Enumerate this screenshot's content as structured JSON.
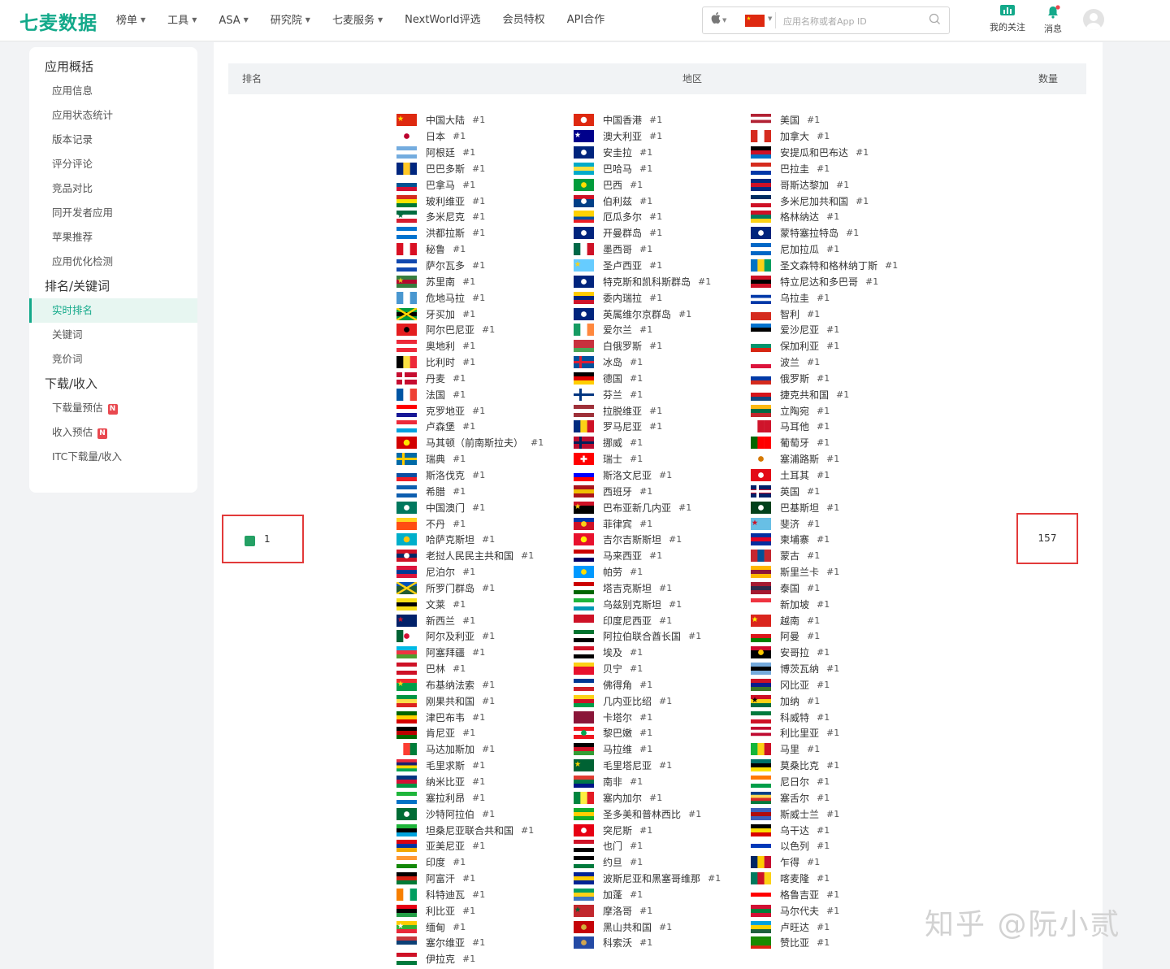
{
  "header": {
    "logo": "七麦数据",
    "nav": [
      {
        "label": "榜单",
        "dropdown": true
      },
      {
        "label": "工具",
        "dropdown": true
      },
      {
        "label": "ASA",
        "dropdown": true
      },
      {
        "label": "研究院",
        "dropdown": true
      },
      {
        "label": "七麦服务",
        "dropdown": true
      },
      {
        "label": "NextWorld评选",
        "dropdown": false
      },
      {
        "label": "会员特权",
        "dropdown": false
      },
      {
        "label": "API合作",
        "dropdown": false
      }
    ],
    "search_placeholder": "应用名称或者App ID",
    "follow_label": "我的关注",
    "message_label": "消息",
    "accent_color": "#13a98a"
  },
  "sidebar": {
    "sections": [
      {
        "title": "应用概括",
        "items": [
          {
            "label": "应用信息"
          },
          {
            "label": "应用状态统计"
          },
          {
            "label": "版本记录"
          },
          {
            "label": "评分评论"
          },
          {
            "label": "竞品对比"
          },
          {
            "label": "同开发者应用"
          },
          {
            "label": "苹果推荐"
          },
          {
            "label": "应用优化检测"
          }
        ]
      },
      {
        "title": "排名/关键词",
        "items": [
          {
            "label": "实时排名",
            "active": true
          },
          {
            "label": "关键词"
          },
          {
            "label": "竞价词"
          }
        ]
      },
      {
        "title": "下载/收入",
        "items": [
          {
            "label": "下载量预估",
            "badge": "N"
          },
          {
            "label": "收入预估",
            "badge": "N"
          },
          {
            "label": "ITC下载量/收入"
          }
        ]
      }
    ]
  },
  "table": {
    "headers": {
      "rank": "排名",
      "region": "地区",
      "count": "数量"
    },
    "rank": "1",
    "count": "157",
    "rank_badge_color": "#24a064",
    "rank_label": "#1"
  },
  "regions": [
    [
      "中国大陆",
      "日本",
      "阿根廷",
      "巴巴多斯",
      "巴拿马",
      "玻利维亚",
      "多米尼克",
      "洪都拉斯",
      "秘鲁",
      "萨尔瓦多",
      "苏里南",
      "危地马拉",
      "牙买加",
      "阿尔巴尼亚",
      "奥地利",
      "比利时",
      "丹麦",
      "法国",
      "克罗地亚",
      "卢森堡",
      "马其顿（前南斯拉夫）",
      "瑞典",
      "斯洛伐克",
      "希腊",
      "中国澳门",
      "不丹",
      "哈萨克斯坦",
      "老挝人民民主共和国",
      "尼泊尔",
      "所罗门群岛",
      "文莱",
      "新西兰",
      "阿尔及利亚",
      "阿塞拜疆",
      "巴林",
      "布基纳法索",
      "刚果共和国",
      "津巴布韦",
      "肯尼亚",
      "马达加斯加",
      "毛里求斯",
      "纳米比亚",
      "塞拉利昂",
      "沙特阿拉伯",
      "坦桑尼亚联合共和国",
      "亚美尼亚",
      "印度",
      "阿富汗",
      "科特迪瓦",
      "利比亚",
      "缅甸",
      "塞尔维亚",
      "伊拉克"
    ],
    [
      "中国香港",
      "澳大利亚",
      "安圭拉",
      "巴哈马",
      "巴西",
      "伯利兹",
      "厄瓜多尔",
      "开曼群岛",
      "墨西哥",
      "圣卢西亚",
      "特克斯和凯科斯群岛",
      "委内瑞拉",
      "英属维尔京群岛",
      "爱尔兰",
      "白俄罗斯",
      "冰岛",
      "德国",
      "芬兰",
      "拉脱维亚",
      "罗马尼亚",
      "挪威",
      "瑞士",
      "斯洛文尼亚",
      "西班牙",
      "巴布亚新几内亚",
      "菲律宾",
      "吉尔吉斯斯坦",
      "马来西亚",
      "帕劳",
      "塔吉克斯坦",
      "乌兹别克斯坦",
      "印度尼西亚",
      "阿拉伯联合酋长国",
      "埃及",
      "贝宁",
      "佛得角",
      "几内亚比绍",
      "卡塔尔",
      "黎巴嫩",
      "马拉维",
      "毛里塔尼亚",
      "南非",
      "塞内加尔",
      "圣多美和普林西比",
      "突尼斯",
      "也门",
      "约旦",
      "波斯尼亚和黑塞哥维那",
      "加蓬",
      "摩洛哥",
      "黑山共和国",
      "科索沃"
    ],
    [
      "美国",
      "加拿大",
      "安提瓜和巴布达",
      "巴拉圭",
      "哥斯达黎加",
      "多米尼加共和国",
      "格林纳达",
      "蒙特塞拉特岛",
      "尼加拉瓜",
      "圣文森特和格林纳丁斯",
      "特立尼达和多巴哥",
      "乌拉圭",
      "智利",
      "爱沙尼亚",
      "保加利亚",
      "波兰",
      "俄罗斯",
      "捷克共和国",
      "立陶宛",
      "马耳他",
      "葡萄牙",
      "塞浦路斯",
      "土耳其",
      "英国",
      "巴基斯坦",
      "斐济",
      "柬埔寨",
      "蒙古",
      "斯里兰卡",
      "泰国",
      "新加坡",
      "越南",
      "阿曼",
      "安哥拉",
      "博茨瓦纳",
      "冈比亚",
      "加纳",
      "科威特",
      "利比里亚",
      "马里",
      "莫桑比克",
      "尼日尔",
      "塞舌尔",
      "斯威士兰",
      "乌干达",
      "以色列",
      "乍得",
      "喀麦隆",
      "格鲁吉亚",
      "马尔代夫",
      "卢旺达",
      "赞比亚"
    ]
  ],
  "flags": [
    [
      [
        "#de2910",
        "#de2910",
        "#de2910",
        "star:#ffde00"
      ],
      [
        "#fff",
        "#fff",
        "#fff",
        "dot:#bc002d"
      ],
      [
        "#74acdf",
        "#fff",
        "#74acdf"
      ],
      [
        "v:#00267f",
        "v:#ffc726",
        "v:#00267f"
      ],
      [
        "#fff",
        "#005293",
        "#d21034"
      ],
      [
        "#d52b1e",
        "#f9e300",
        "#007934"
      ],
      [
        "#006b3f",
        "#fff",
        "#d41c30",
        "star:#006b3f"
      ],
      [
        "#0073cf",
        "#fff",
        "#0073cf"
      ],
      [
        "v:#d91023",
        "v:#fff",
        "v:#d91023"
      ],
      [
        "#0f47af",
        "#fff",
        "#0f47af"
      ],
      [
        "#377e3f",
        "#b40a2d",
        "#377e3f",
        "star:#ecc81d"
      ],
      [
        "v:#4997d0",
        "v:#fff",
        "v:#4997d0"
      ],
      [
        "#009b3a",
        "#000",
        "#009b3a",
        "x:#fed100"
      ],
      [
        "#e41e20",
        "#e41e20",
        "#e41e20",
        "dot:#000"
      ],
      [
        "#ed2939",
        "#fff",
        "#ed2939"
      ],
      [
        "v:#000",
        "v:#fae042",
        "v:#ed2939"
      ],
      [
        "#c60c30",
        "#c60c30",
        "#c60c30",
        "cross:#fff"
      ],
      [
        "v:#0055a4",
        "v:#fff",
        "v:#ef4135"
      ],
      [
        "#ff0000",
        "#fff",
        "#171796"
      ],
      [
        "#ed2939",
        "#fff",
        "#00a1de"
      ],
      [
        "#d20000",
        "#d20000",
        "#d20000",
        "sun:#ffe600"
      ],
      [
        "#006aa7",
        "#006aa7",
        "#006aa7",
        "cross:#fecc00"
      ],
      [
        "#fff",
        "#0b4ea2",
        "#ee1c25"
      ],
      [
        "#0d5eaf",
        "#fff",
        "#0d5eaf"
      ],
      [
        "#00785e",
        "#00785e",
        "#00785e",
        "dot:#fff"
      ],
      [
        "#ffd520",
        "#ff4e12",
        "#ff4e12"
      ],
      [
        "#00afca",
        "#00afca",
        "#00afca",
        "sun:#fec50c"
      ],
      [
        "#ce1126",
        "#002868",
        "#ce1126",
        "dot:#fff"
      ],
      [
        "#dc143c",
        "#003893",
        "#dc143c"
      ],
      [
        "#0051ba",
        "#215b33",
        "#215b33",
        "x:#fcd116"
      ],
      [
        "#f7e017",
        "#000",
        "#f7e017"
      ],
      [
        "#012169",
        "#012169",
        "#012169",
        "star:#cc142b"
      ],
      [
        "v:#006233",
        "v:#fff",
        "v:#fff",
        "dot:#d21034"
      ],
      [
        "#00b9e4",
        "#ef3340",
        "#509e2f"
      ],
      [
        "#ce1126",
        "#fff",
        "#ce1126"
      ],
      [
        "#ef2b2d",
        "#009e49",
        "#009e49",
        "star:#fcd116"
      ],
      [
        "#009543",
        "#fbde4a",
        "#dc241f"
      ],
      [
        "#006400",
        "#ffd200",
        "#d40000"
      ],
      [
        "#000",
        "#bb0000",
        "#006600"
      ],
      [
        "v:#fff",
        "#fc3d32",
        "#007e3a"
      ],
      [
        "#ea2839",
        "#1a206d",
        "#ffd500",
        "#00a551"
      ],
      [
        "#003580",
        "#d21034",
        "#009543"
      ],
      [
        "#1eb53a",
        "#fff",
        "#0072c6"
      ],
      [
        "#006c35",
        "#006c35",
        "#006c35",
        "dot:#fff"
      ],
      [
        "#1eb53a",
        "#000",
        "#00a3dd"
      ],
      [
        "#d90012",
        "#0033a0",
        "#f2a800"
      ],
      [
        "#ff9933",
        "#fff",
        "#138808"
      ],
      [
        "#000",
        "#d32011",
        "#007a36"
      ],
      [
        "v:#f77f00",
        "v:#fff",
        "v:#009e60"
      ],
      [
        "#e70013",
        "#000",
        "#239e46"
      ],
      [
        "#fecb00",
        "#34b233",
        "#ea2839",
        "star:#fff"
      ],
      [
        "#c6363c",
        "#0c4076",
        "#fff"
      ],
      [
        "#ce1126",
        "#fff",
        "#007a3d"
      ]
    ],
    [
      [
        "#de2910",
        "#de2910",
        "#de2910",
        "sun:#fff"
      ],
      [
        "#00008b",
        "#00008b",
        "#00008b",
        "star:#fff"
      ],
      [
        "#00247d",
        "#00247d",
        "#00247d",
        "dot:#fff"
      ],
      [
        "#00abc9",
        "#fae042",
        "#00abc9"
      ],
      [
        "#009c3b",
        "#009c3b",
        "#009c3b",
        "dot:#ffdf00"
      ],
      [
        "#ce1126",
        "#003f87",
        "#003f87",
        "dot:#fff"
      ],
      [
        "#ffd100",
        "#ffd100",
        "#034ea2",
        "#ed1c24"
      ],
      [
        "#00247d",
        "#00247d",
        "#00247d",
        "dot:#fff"
      ],
      [
        "v:#006847",
        "v:#fff",
        "v:#ce1126"
      ],
      [
        "#66ccff",
        "#66ccff",
        "#66ccff",
        "star:#fcd116"
      ],
      [
        "#00247d",
        "#00247d",
        "#00247d",
        "dot:#fff"
      ],
      [
        "#ffcc00",
        "#00247d",
        "#cf142b"
      ],
      [
        "#00247d",
        "#00247d",
        "#00247d",
        "dot:#fff"
      ],
      [
        "v:#169b62",
        "v:#fff",
        "v:#ff883e"
      ],
      [
        "#c8313e",
        "#c8313e",
        "#4aa657"
      ],
      [
        "#02529c",
        "#02529c",
        "#02529c",
        "cross:#dc1e35"
      ],
      [
        "#000",
        "#dd0000",
        "#ffce00"
      ],
      [
        "#fff",
        "#fff",
        "#fff",
        "cross:#003580"
      ],
      [
        "#9e3039",
        "#fff",
        "#9e3039"
      ],
      [
        "v:#002b7f",
        "v:#fcd116",
        "v:#ce1126"
      ],
      [
        "#ba0c2f",
        "#ba0c2f",
        "#ba0c2f",
        "cross:#00205b"
      ],
      [
        "#ff0000",
        "#ff0000",
        "#ff0000",
        "plus:#fff"
      ],
      [
        "#fff",
        "#0000ff",
        "#ff0000"
      ],
      [
        "#aa151b",
        "#f1bf00",
        "#aa151b"
      ],
      [
        "#ce1126",
        "#000",
        "#000",
        "star:#fcd116"
      ],
      [
        "#0038a8",
        "#ce1126",
        "#ce1126",
        "dot:#fcd116"
      ],
      [
        "#e8112d",
        "#e8112d",
        "#e8112d",
        "sun:#ffef00"
      ],
      [
        "#cc0001",
        "#fff",
        "#010066"
      ],
      [
        "#0099ff",
        "#0099ff",
        "#0099ff",
        "dot:#ffde00"
      ],
      [
        "#cc0000",
        "#fff",
        "#006600"
      ],
      [
        "#1eb53a",
        "#fff",
        "#0099b5"
      ],
      [
        "#ce1126",
        "#ce1126",
        "#fff"
      ],
      [
        "#00732f",
        "#fff",
        "#000"
      ],
      [
        "#ce1126",
        "#fff",
        "#000"
      ],
      [
        "#fcd116",
        "#e8112d",
        "#e8112d"
      ],
      [
        "#003893",
        "#fff",
        "#cf2027"
      ],
      [
        "#fcd116",
        "#ce1126",
        "#009e49"
      ],
      [
        "#8a1538",
        "#8a1538",
        "#8a1538"
      ],
      [
        "#ee161f",
        "#fff",
        "#ee161f",
        "dot:#00a850"
      ],
      [
        "#000",
        "#ce1126",
        "#339e35"
      ],
      [
        "#006233",
        "#006233",
        "#006233",
        "star:#ffd700"
      ],
      [
        "#e03c31",
        "#007749",
        "#001489"
      ],
      [
        "v:#00853f",
        "v:#fdef42",
        "v:#e31b23"
      ],
      [
        "#12ad2b",
        "#ffce00",
        "#12ad2b"
      ],
      [
        "#e70013",
        "#e70013",
        "#e70013",
        "dot:#fff"
      ],
      [
        "#ce1126",
        "#fff",
        "#000"
      ],
      [
        "#000",
        "#fff",
        "#007a3d"
      ],
      [
        "#002395",
        "#fecb00",
        "#002395"
      ],
      [
        "#009e60",
        "#fcd116",
        "#3a75c4"
      ],
      [
        "#c1272d",
        "#c1272d",
        "#c1272d",
        "star:#006233"
      ],
      [
        "#c40308",
        "#c40308",
        "#c40308",
        "dot:#d3ae3b"
      ],
      [
        "#244aa5",
        "#244aa5",
        "#244aa5",
        "dot:#d0a650"
      ]
    ],
    [
      [
        "#b22234",
        "#fff",
        "#b22234",
        "#fff"
      ],
      [
        "v:#d52b1e",
        "v:#fff",
        "v:#d52b1e"
      ],
      [
        "#000",
        "#ce1126",
        "#0072c6"
      ],
      [
        "#d52b1e",
        "#fff",
        "#0038a8"
      ],
      [
        "#002b7f",
        "#ce1126",
        "#002b7f"
      ],
      [
        "#002d62",
        "#fff",
        "#ce1126"
      ],
      [
        "#ce1126",
        "#007a5e",
        "#fcd116"
      ],
      [
        "#00247d",
        "#00247d",
        "#00247d",
        "dot:#fff"
      ],
      [
        "#0067c6",
        "#fff",
        "#0067c6"
      ],
      [
        "v:#0072c6",
        "v:#fcd116",
        "v:#009e60"
      ],
      [
        "#ce1126",
        "#000",
        "#ce1126"
      ],
      [
        "#fff",
        "#0038a8",
        "#fff",
        "#0038a8"
      ],
      [
        "#fff",
        "#d52b1e",
        "#d52b1e"
      ],
      [
        "#0072ce",
        "#000",
        "#fff"
      ],
      [
        "#fff",
        "#00966e",
        "#d62612"
      ],
      [
        "#fff",
        "#fff",
        "#dc143c"
      ],
      [
        "#fff",
        "#0039a6",
        "#d52b1e"
      ],
      [
        "#fff",
        "#d7141a",
        "#11457e"
      ],
      [
        "#fdb913",
        "#006a44",
        "#c1272d"
      ],
      [
        "v:#fff",
        "v:#cf142b",
        "v:#cf142b"
      ],
      [
        "v:#006600",
        "v:#ff0000",
        "v:#ff0000"
      ],
      [
        "#fff",
        "#fff",
        "#fff",
        "dot:#d57800"
      ],
      [
        "#e30a17",
        "#e30a17",
        "#e30a17",
        "dot:#fff"
      ],
      [
        "#012169",
        "#c8102e",
        "#012169",
        "cross:#fff"
      ],
      [
        "#01411c",
        "#01411c",
        "#01411c",
        "dot:#fff"
      ],
      [
        "#68bfe5",
        "#68bfe5",
        "#68bfe5",
        "star:#ce1126"
      ],
      [
        "#032ea1",
        "#e00025",
        "#032ea1"
      ],
      [
        "v:#c4272f",
        "v:#015197",
        "v:#c4272f"
      ],
      [
        "#ffb700",
        "#8d153a",
        "#ffb700"
      ],
      [
        "#a51931",
        "#2d2a4a",
        "#a51931"
      ],
      [
        "#ef3340",
        "#fff",
        "#fff"
      ],
      [
        "#da251d",
        "#da251d",
        "#da251d",
        "star:#ffff00"
      ],
      [
        "#fff",
        "#db161b",
        "#008000"
      ],
      [
        "#cc092f",
        "#000",
        "#000",
        "dot:#ffcb00"
      ],
      [
        "#75aadb",
        "#000",
        "#75aadb"
      ],
      [
        "#ce1126",
        "#0c1c8c",
        "#3a7728"
      ],
      [
        "#ce1126",
        "#fcd116",
        "#006b3f",
        "star:#000"
      ],
      [
        "#007a3d",
        "#fff",
        "#ce1126"
      ],
      [
        "#bf0a30",
        "#fff",
        "#bf0a30",
        "#fff"
      ],
      [
        "v:#14b53a",
        "v:#fcd116",
        "v:#ce1126"
      ],
      [
        "#007168",
        "#000",
        "#fce100"
      ],
      [
        "#ff7900",
        "#fff",
        "#009e49"
      ],
      [
        "#003f87",
        "#fcd856",
        "#d62828",
        "#007a3d"
      ],
      [
        "#3e5eb9",
        "#b10c0c",
        "#3e5eb9"
      ],
      [
        "#000",
        "#fcdc04",
        "#d90000"
      ],
      [
        "#fff",
        "#0038b8",
        "#fff"
      ],
      [
        "v:#002664",
        "v:#fecb00",
        "v:#c60c30"
      ],
      [
        "v:#007a5e",
        "v:#ce1126",
        "v:#fcd116"
      ],
      [
        "#fff",
        "#ff0000",
        "#fff"
      ],
      [
        "#d21034",
        "#007e3a",
        "#d21034"
      ],
      [
        "#00a1de",
        "#fad201",
        "#20603d"
      ],
      [
        "#198a00",
        "#198a00",
        "#198a00",
        "#de2010"
      ]
    ]
  ]
}
